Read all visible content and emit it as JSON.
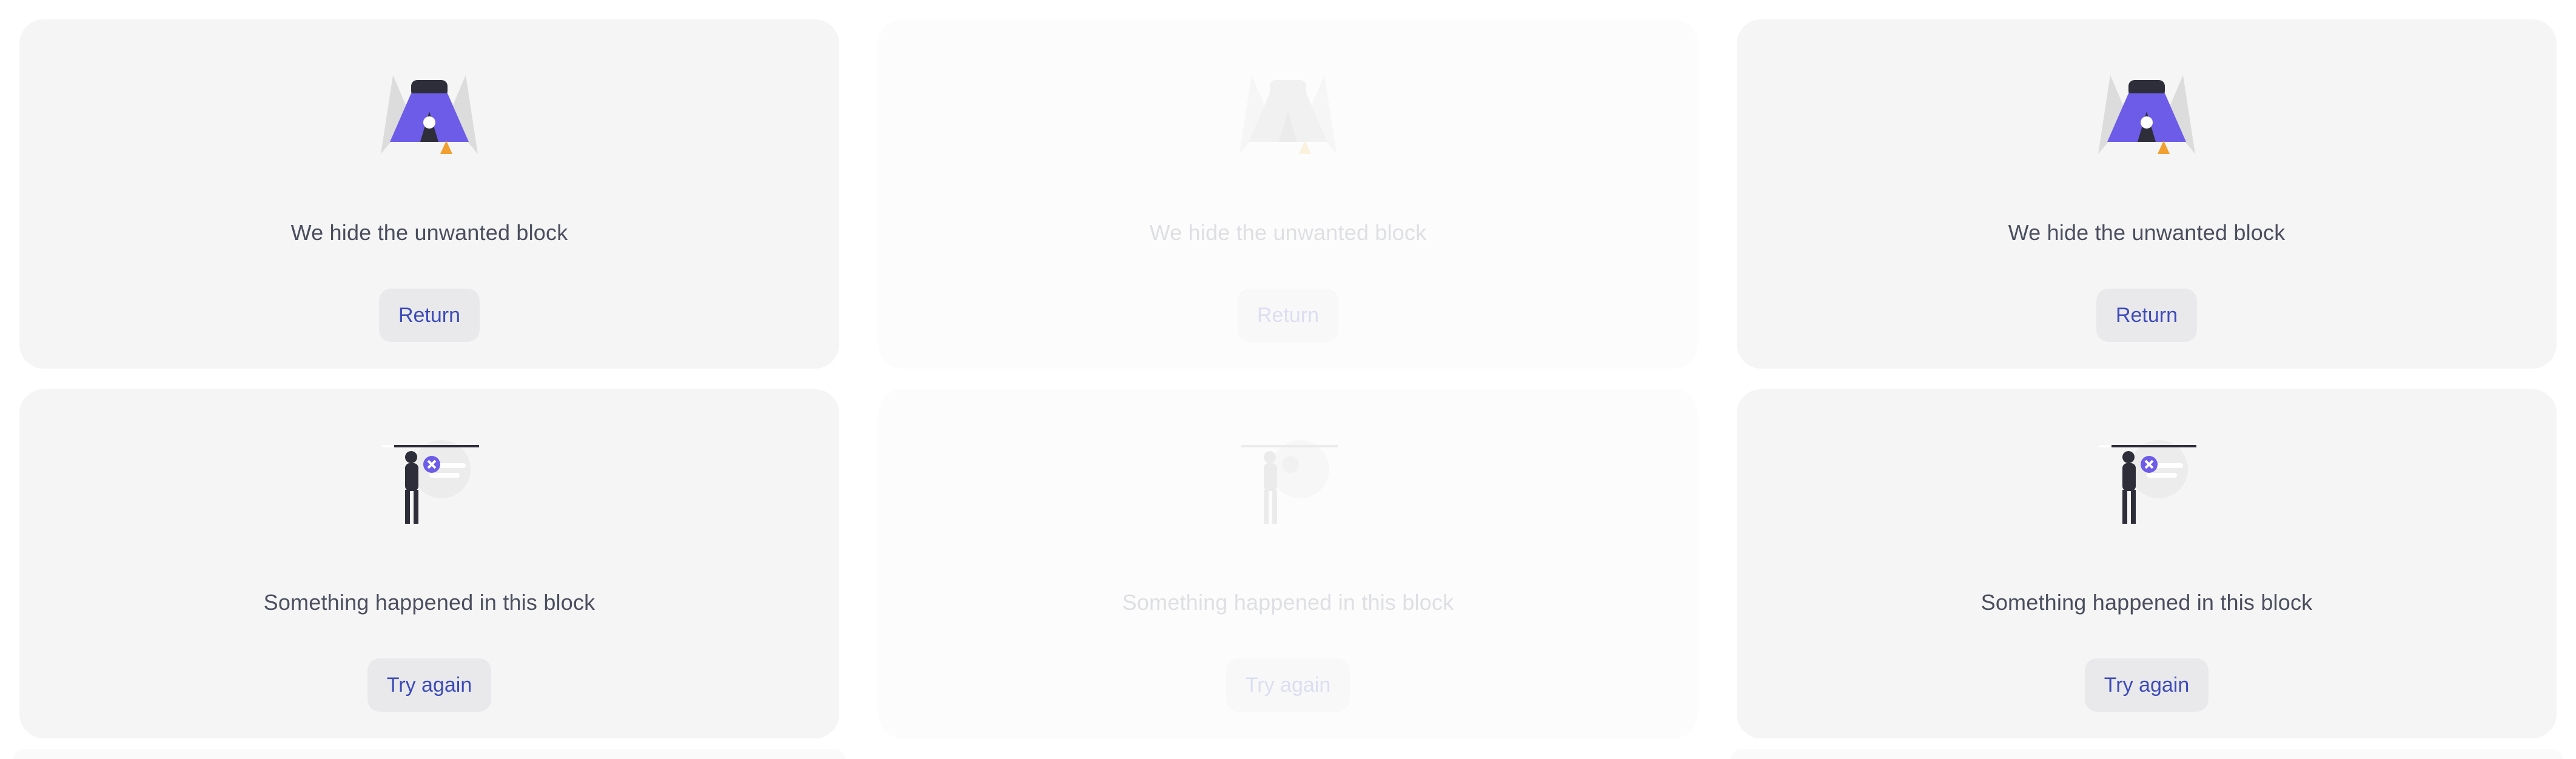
{
  "states": {
    "hidden": {
      "message": "We hide the unwanted block",
      "button": "Return",
      "icon": "camping-tent-icon"
    },
    "error": {
      "message": "Something happened in this block",
      "button": "Try again",
      "icon": "broken-window-icon"
    }
  },
  "colors": {
    "card_bg": "#f5f5f5",
    "text": "#4a4e5e",
    "button_bg": "#e9e9ec",
    "button_text": "#3d4bb8",
    "accent": "#6c5ce7"
  }
}
